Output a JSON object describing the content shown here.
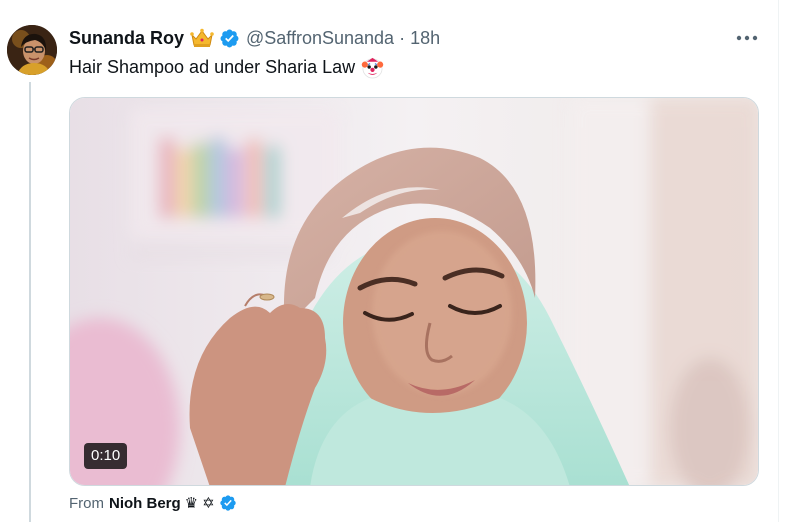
{
  "tweet": {
    "author": {
      "display_name": "Sunanda Roy",
      "handle": "@SaffronSunanda",
      "avatar_icon": "avatar-woman-glasses",
      "badge_icon": "crown-icon",
      "verified_icon": "verified-badge-icon"
    },
    "separator": "·",
    "time": "18h",
    "more_icon": "more-horizontal-icon",
    "text": "Hair Shampoo ad under Sharia Law",
    "text_emoji_icon": "clown-face-icon",
    "media": {
      "kind": "video",
      "duration": "0:10"
    },
    "attribution": {
      "from_label": "From",
      "source_name": "Nioh Berg",
      "icons": [
        "queen-chess-icon",
        "star-of-david-icon",
        "verified-badge-icon"
      ]
    }
  },
  "colors": {
    "text_primary": "#0f1419",
    "text_secondary": "#536471",
    "verified_blue": "#1d9bf0",
    "thread_line": "#cfd9de",
    "crown_gold": "#f5b82e"
  }
}
